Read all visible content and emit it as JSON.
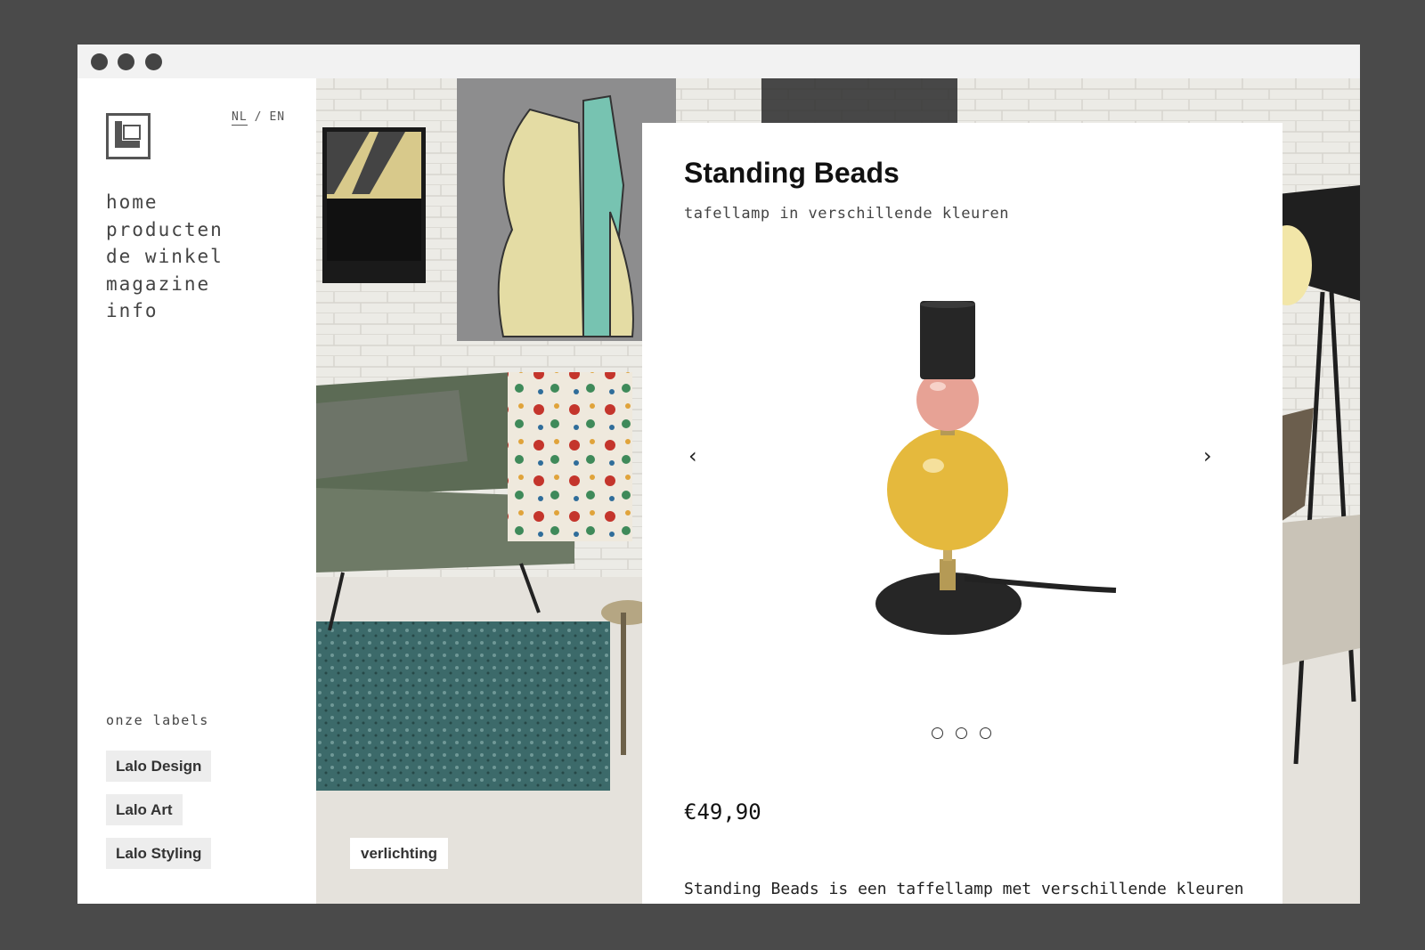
{
  "language": {
    "nl": "NL",
    "separator": "/",
    "en": "EN"
  },
  "nav": [
    "home",
    "producten",
    "de winkel",
    "magazine",
    "info"
  ],
  "labels": {
    "title": "onze labels",
    "items": [
      "Lalo Design",
      "Lalo Art",
      "Lalo Styling"
    ]
  },
  "category_tag": "verlichting",
  "product": {
    "name": "Standing Beads",
    "subtitle": "tafellamp in verschillende kleuren",
    "price": "€49,90",
    "description": "Standing Beads is een taffellamp met verschillende kleuren",
    "carousel": {
      "prev_icon": "‹",
      "next_icon": "›",
      "slides": 3
    }
  },
  "colors": {
    "frame": "#4a4a4a",
    "lamp_pink": "#e7a295",
    "lamp_yellow": "#e5b93d",
    "lamp_black": "#262626"
  }
}
